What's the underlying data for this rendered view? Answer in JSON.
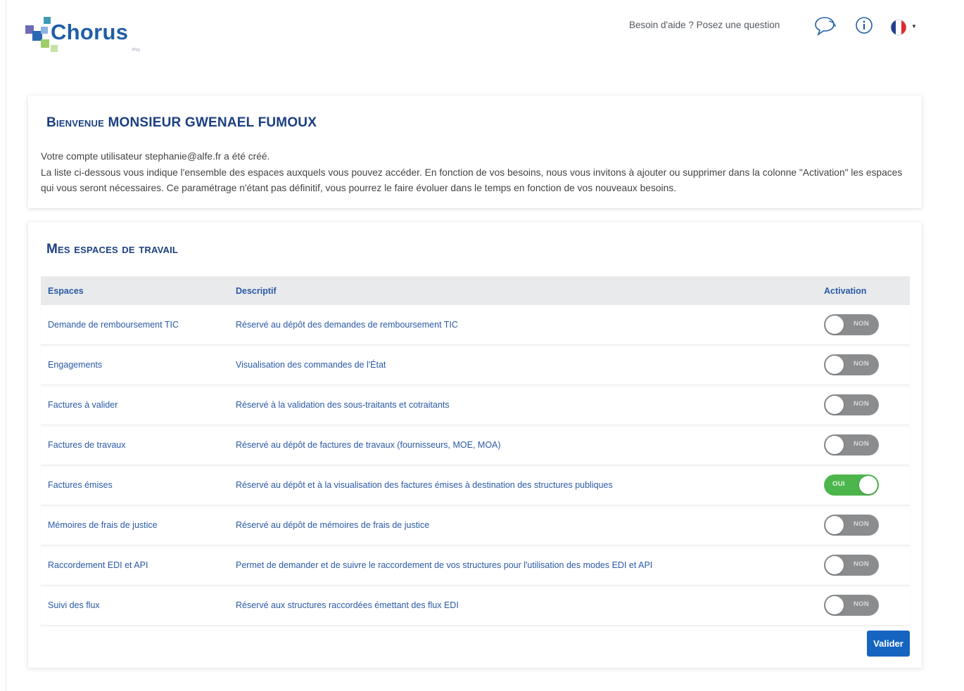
{
  "header": {
    "logo_text": "Chorus",
    "logo_sub": "Pro",
    "help_text": "Besoin d'aide ? Posez une question",
    "icons": [
      "chat-bubble-icon",
      "info-icon",
      "french-flag-icon",
      "caret-down-icon"
    ]
  },
  "welcome": {
    "title": "Bienvenue MONSIEUR GWENAEL FUMOUX",
    "line1": "Votre compte utilisateur stephanie@alfe.fr a été créé.",
    "line2": "La liste ci-dessous vous indique l'ensemble des espaces auxquels vous pouvez accéder. En fonction de vos besoins, nous vous invitons à ajouter ou supprimer dans la colonne \"Activation\" les espaces qui vous seront nécessaires. Ce paramétrage n'étant pas définitif, vous pourrez le faire évoluer dans le temps en fonction de vos nouveaux besoins."
  },
  "workspaces": {
    "title": "Mes espaces de travail",
    "columns": {
      "space": "Espaces",
      "desc": "Descriptif",
      "activation": "Activation"
    },
    "rows": [
      {
        "space": "Demande de remboursement TIC",
        "desc": "Réservé au dépôt des demandes de remboursement TIC",
        "state": "NON",
        "on": false
      },
      {
        "space": "Engagements",
        "desc": "Visualisation des commandes de l'État",
        "state": "NON",
        "on": false
      },
      {
        "space": "Factures à valider",
        "desc": "Réservé à la validation des sous-traitants et cotraitants",
        "state": "NON",
        "on": false
      },
      {
        "space": "Factures de travaux",
        "desc": "Réservé au dépôt de factures de travaux (fournisseurs, MOE, MOA)",
        "state": "NON",
        "on": false
      },
      {
        "space": "Factures émises",
        "desc": "Réservé au dépôt et à la visualisation des factures émises à destination des structures publiques",
        "state": "OUI",
        "on": true
      },
      {
        "space": "Mémoires de frais de justice",
        "desc": "Réservé au dépôt de mémoires de frais de justice",
        "state": "NON",
        "on": false
      },
      {
        "space": "Raccordement EDI et API",
        "desc": "Permet de demander et de suivre le raccordement de vos structures pour l'utilisation des modes EDI et API",
        "state": "NON",
        "on": false
      },
      {
        "space": "Suivi des flux",
        "desc": "Réservé aux structures raccordées émettant des flux EDI",
        "state": "NON",
        "on": false
      }
    ],
    "validate_label": "Valider"
  },
  "colors": {
    "brand_blue": "#1b3f82",
    "link_blue": "#2a5aa6",
    "toggle_on": "#4cb64c",
    "toggle_off": "#8a8c8e",
    "button": "#1565c0"
  }
}
